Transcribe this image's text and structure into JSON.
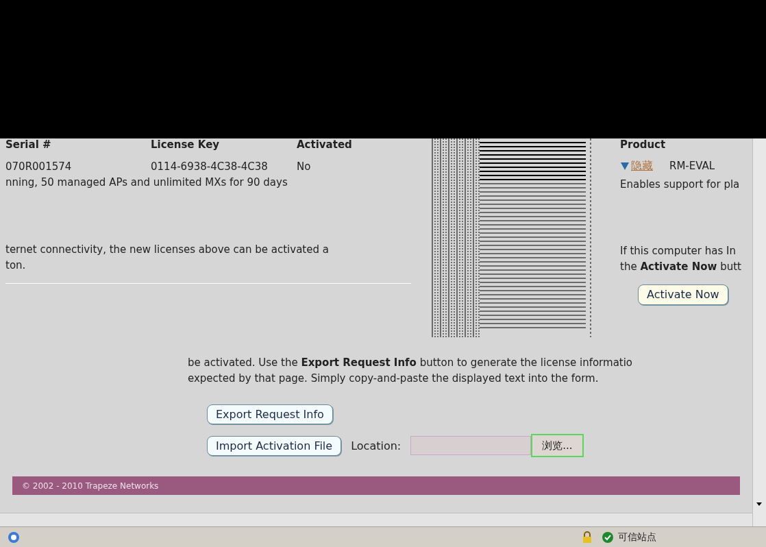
{
  "licenses_table": {
    "columns": [
      "Serial #",
      "License Key",
      "Activated"
    ],
    "rows": [
      {
        "cells": [
          "070R001574",
          "0114-6938-4C38-4C38",
          "No"
        ],
        "description": "nning, 50 managed APs and unlimited MXs for 90 days"
      }
    ]
  },
  "activation_note": [
    "ternet connectivity, the new licenses above can be activated a",
    "ton."
  ],
  "product_panel": {
    "heading": "Product",
    "toggle_link": "隐藏",
    "product": "RM-EVAL",
    "description": "Enables support for pla",
    "note": [
      "If this computer has In",
      "the **Activate Now** butt"
    ],
    "button": "Activate Now"
  },
  "manual_activation": {
    "lines": [
      "be activated. Use the **Export Request Info** button to generate the license informatio",
      "expected by that page. Simply copy-and-paste the displayed text into the form."
    ],
    "export_button": "Export Request Info",
    "import_button": "Import Activation File",
    "location_label": "Location:",
    "browse_button": "浏览..."
  },
  "footer": "© 2002 - 2010 Trapeze Networks",
  "status_bar": {
    "zone": "可信站点"
  }
}
